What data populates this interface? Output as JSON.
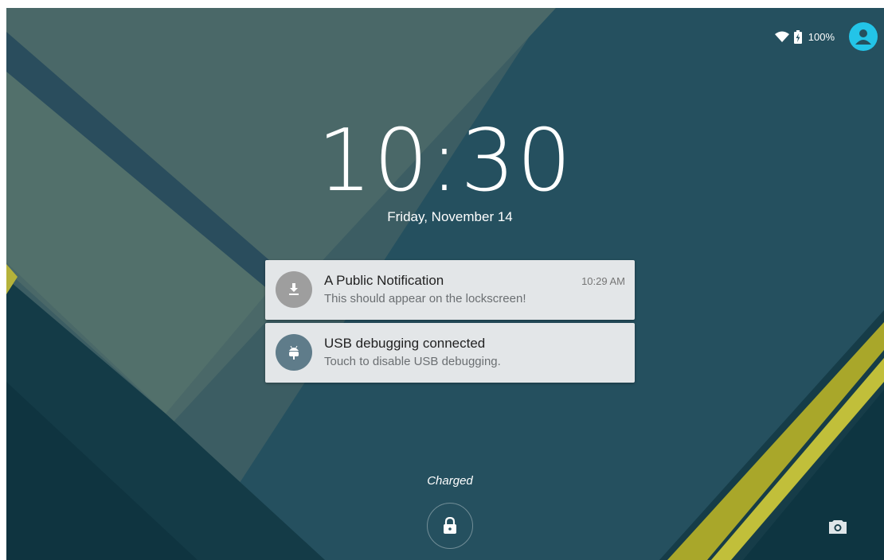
{
  "status_bar": {
    "battery_percent": "100%",
    "icons": [
      "wifi-icon",
      "battery-charging-icon",
      "user-avatar-icon"
    ]
  },
  "lockscreen": {
    "time": "10:30",
    "date": "Friday, November 14",
    "charge_status": "Charged"
  },
  "notifications": [
    {
      "title": "A Public Notification",
      "text": "This should appear on the lockscreen!",
      "time": "10:29 AM",
      "icon": "download-icon"
    },
    {
      "title": "USB debugging connected",
      "text": "Touch to disable USB debugging.",
      "time": "",
      "icon": "android-icon"
    }
  ],
  "bottom_actions": [
    "lock-icon",
    "camera-icon"
  ],
  "colors": {
    "wallpaper_base": "#25505f",
    "accent_yellow": "#a9a72a",
    "avatar": "#23c4e8",
    "notification_bg": "#e3e6e8"
  }
}
